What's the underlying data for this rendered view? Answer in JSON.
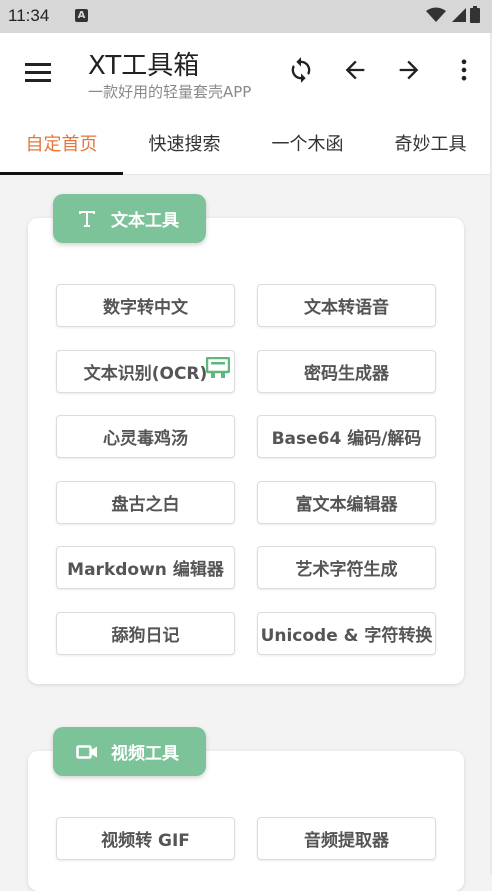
{
  "status_bar": {
    "time": "11:34",
    "notif_letter": "A"
  },
  "toolbar": {
    "title": "XT工具箱",
    "subtitle": "一款好用的轻量套壳APP"
  },
  "tabs": [
    {
      "label": "自定首页",
      "active": true
    },
    {
      "label": "快速搜索",
      "active": false
    },
    {
      "label": "一个木函",
      "active": false
    },
    {
      "label": "奇妙工具",
      "active": false
    }
  ],
  "sections": [
    {
      "title": "文本工具",
      "icon": "text-icon",
      "tools": [
        "数字转中文",
        "文本转语音",
        "文本识别(OCR)",
        "密码生成器",
        "心灵毒鸡汤",
        "Base64 编码/解码",
        "盘古之白",
        "富文本编辑器",
        "Markdown 编辑器",
        "艺术字符生成",
        "舔狗日记",
        "Unicode & 字符转换"
      ]
    },
    {
      "title": "视频工具",
      "icon": "video-camera-icon",
      "tools": [
        "视频转 GIF",
        "音频提取器"
      ]
    }
  ],
  "colors": {
    "accent": "#e8743b",
    "badge": "#7cc39a",
    "ocr_icon": "#5cb87d"
  }
}
